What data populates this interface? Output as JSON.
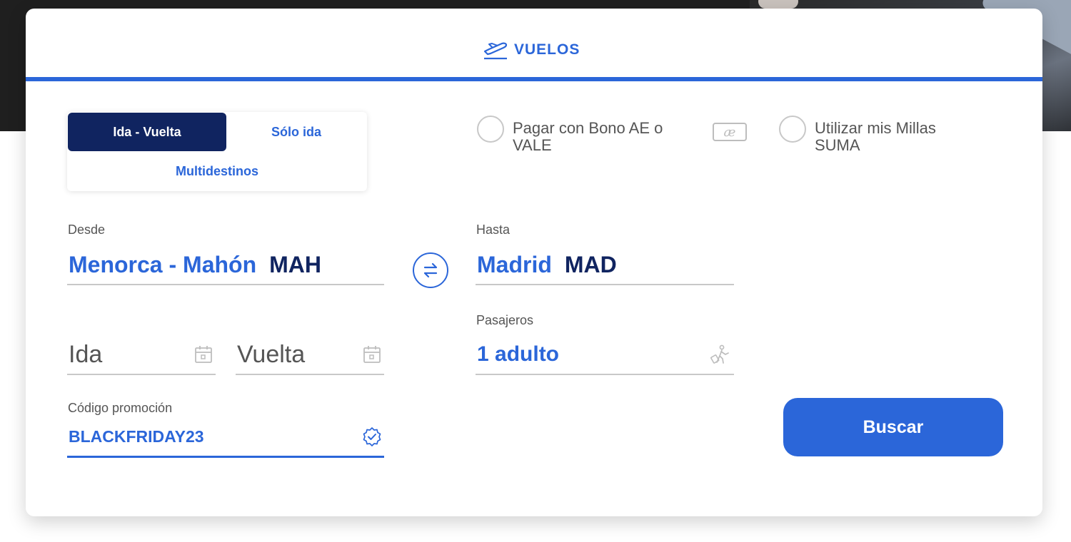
{
  "header": {
    "tab_label": "VUELOS",
    "tab_icon": "plane-takeoff-icon",
    "accent_color": "#2b66d9"
  },
  "trip_type": {
    "options": [
      "Ida - Vuelta",
      "Sólo ida",
      "Multidestinos"
    ],
    "selected": "Ida - Vuelta"
  },
  "payment_options": {
    "bono": "Pagar con Bono AE o VALE",
    "bono_badge": "æ",
    "millas": "Utilizar mis Millas SUMA"
  },
  "origin": {
    "label": "Desde",
    "city": "Menorca - Mahón",
    "code": "MAH"
  },
  "destination": {
    "label": "Hasta",
    "city": "Madrid",
    "code": "MAD"
  },
  "dates": {
    "departure_placeholder": "Ida",
    "return_placeholder": "Vuelta"
  },
  "passengers": {
    "label": "Pasajeros",
    "value": "1 adulto"
  },
  "promo": {
    "label": "Código promoción",
    "value": "BLACKFRIDAY23"
  },
  "search_button": "Buscar"
}
